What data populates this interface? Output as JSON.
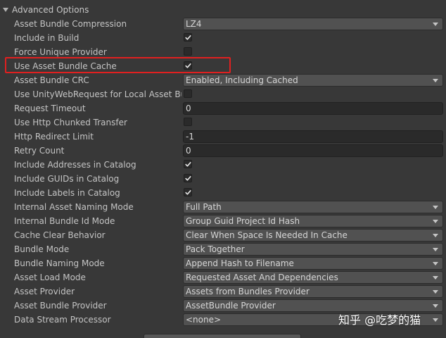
{
  "section": {
    "title": "Advanced Options"
  },
  "rows": [
    {
      "label": "Asset Bundle Compression",
      "kind": "dropdown",
      "value": "LZ4"
    },
    {
      "label": "Include in Build",
      "kind": "check",
      "checked": true
    },
    {
      "label": "Force Unique Provider",
      "kind": "check",
      "checked": false
    },
    {
      "label": "Use Asset Bundle Cache",
      "kind": "check",
      "checked": true
    },
    {
      "label": "Asset Bundle CRC",
      "kind": "dropdown",
      "value": "Enabled, Including Cached"
    },
    {
      "label": "Use UnityWebRequest for Local Asset Bundles",
      "kind": "check",
      "checked": false
    },
    {
      "label": "Request Timeout",
      "kind": "text",
      "value": "0"
    },
    {
      "label": "Use Http Chunked Transfer",
      "kind": "check",
      "checked": false
    },
    {
      "label": "Http Redirect Limit",
      "kind": "text",
      "value": "-1"
    },
    {
      "label": "Retry Count",
      "kind": "text",
      "value": "0"
    },
    {
      "label": "Include Addresses in Catalog",
      "kind": "check",
      "checked": true
    },
    {
      "label": "Include GUIDs in Catalog",
      "kind": "check",
      "checked": true
    },
    {
      "label": "Include Labels in Catalog",
      "kind": "check",
      "checked": true
    },
    {
      "label": "Internal Asset Naming Mode",
      "kind": "dropdown",
      "value": "Full Path"
    },
    {
      "label": "Internal Bundle Id Mode",
      "kind": "dropdown",
      "value": "Group Guid Project Id Hash"
    },
    {
      "label": "Cache Clear Behavior",
      "kind": "dropdown",
      "value": "Clear When Space Is Needed In Cache"
    },
    {
      "label": "Bundle Mode",
      "kind": "dropdown",
      "value": "Pack Together"
    },
    {
      "label": "Bundle Naming Mode",
      "kind": "dropdown",
      "value": "Append Hash to Filename"
    },
    {
      "label": "Asset Load Mode",
      "kind": "dropdown",
      "value": "Requested Asset And Dependencies"
    },
    {
      "label": "Asset Provider",
      "kind": "dropdown",
      "value": "Assets from Bundles Provider"
    },
    {
      "label": "Asset Bundle Provider",
      "kind": "dropdown",
      "value": "AssetBundle Provider"
    },
    {
      "label": "Data Stream Processor",
      "kind": "dropdown",
      "value": "<none>"
    }
  ],
  "highlighted_row": "Use Asset Bundle Cache",
  "watermark": "知乎 @吃梦的猫",
  "colors": {
    "background": "#383838",
    "dropdown": "#515151",
    "field": "#2a2a2a",
    "highlight": "#e02020",
    "text": "#c4c4c4"
  }
}
